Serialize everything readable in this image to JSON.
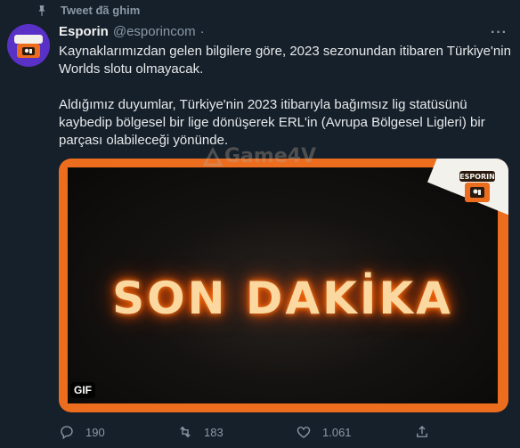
{
  "pinned_label": "Tweet đã ghim",
  "tweet": {
    "name": "Esporin",
    "handle": "@esporincom",
    "separator": "·",
    "more": "···",
    "paragraph1": "Kaynaklarımızdan gelen bilgilere göre, 2023 sezonundan itibaren Türkiye'nin Worlds slotu olmayacak.",
    "paragraph2": "Aldığımız duyumlar, Türkiye'nin 2023 itibarıyla bağımsız lig statüsünü kaybedip bölgesel bir lige dönüşerek ERL'in (Avrupa Bölgesel Ligleri) bir parçası olabileceği yönünde."
  },
  "media": {
    "headline": "SON DAKİKA",
    "badge": "GIF",
    "watermark": "Game4V",
    "logo_text": "ESPORIN",
    "frame_color": "#ed6d1f"
  },
  "actions": {
    "reply_count": "190",
    "retweet_count": "183",
    "like_count": "1.061"
  },
  "icons": [
    "pin-icon",
    "reply-icon",
    "retweet-icon",
    "like-icon",
    "share-icon"
  ],
  "colors": {
    "background": "#15202b",
    "text": "#e7e9ea",
    "muted": "#8b98a5",
    "avatar": "#5a31c7"
  }
}
